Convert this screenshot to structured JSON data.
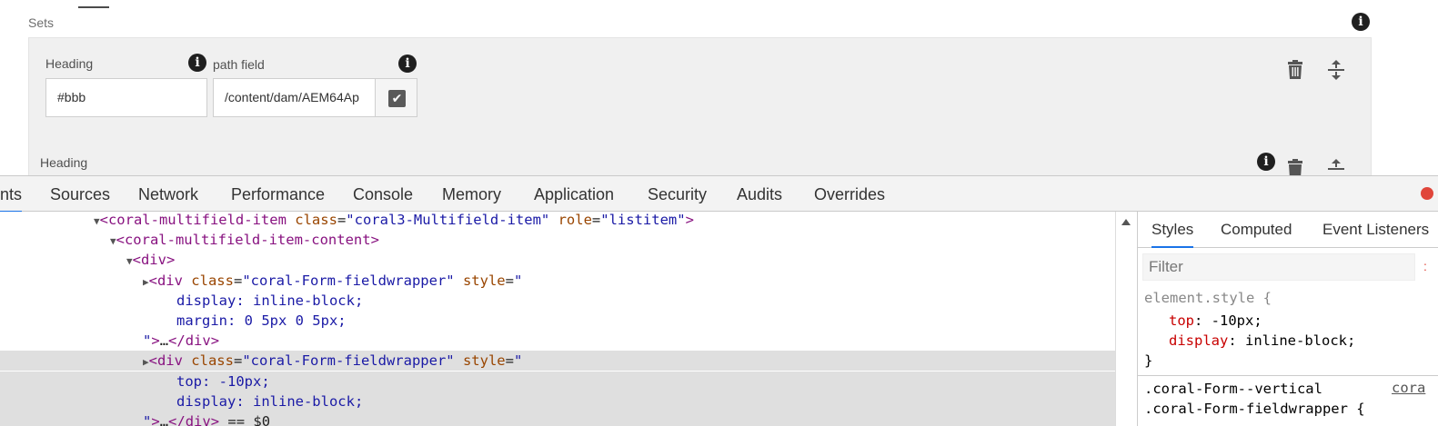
{
  "form": {
    "sets_label": "Sets",
    "item1": {
      "heading_label": "Heading",
      "heading_value": "#bbb",
      "path_label": "path field",
      "path_value": "/content/dam/AEM64Ap"
    },
    "item2": {
      "heading_label": "Heading"
    }
  },
  "devtools": {
    "tabs": [
      "nts",
      "Sources",
      "Network",
      "Performance",
      "Console",
      "Memory",
      "Application",
      "Security",
      "Audits",
      "Overrides"
    ],
    "active_tab": "nts",
    "elements": [
      {
        "indent": 103,
        "tri": "▼",
        "parts": [
          [
            "tag",
            "<coral-multifield-item "
          ],
          [
            "attr",
            "class"
          ],
          [
            "txt",
            "="
          ],
          [
            "val",
            "\"coral3-Multifield-item\""
          ],
          [
            "txt",
            " "
          ],
          [
            "attr",
            "role"
          ],
          [
            "txt",
            "="
          ],
          [
            "val",
            "\"listitem\""
          ],
          [
            "tag",
            ">"
          ]
        ]
      },
      {
        "indent": 121,
        "tri": "▼",
        "parts": [
          [
            "tag",
            "<coral-multifield-item-content>"
          ]
        ]
      },
      {
        "indent": 139,
        "tri": "▼",
        "parts": [
          [
            "tag",
            "<div>"
          ]
        ]
      },
      {
        "indent": 157,
        "tri": "▶",
        "parts": [
          [
            "tag",
            "<div "
          ],
          [
            "attr",
            "class"
          ],
          [
            "txt",
            "="
          ],
          [
            "val",
            "\"coral-Form-fieldwrapper\""
          ],
          [
            "txt",
            " "
          ],
          [
            "attr",
            "style"
          ],
          [
            "txt",
            "="
          ],
          [
            "val",
            "\""
          ]
        ]
      },
      {
        "indent": 194,
        "tri": "",
        "parts": [
          [
            "val",
            "display: inline-block;"
          ]
        ]
      },
      {
        "indent": 194,
        "tri": "",
        "parts": [
          [
            "val",
            "margin: 0 5px 0 5px;"
          ]
        ]
      },
      {
        "indent": 157,
        "tri": "",
        "parts": [
          [
            "val",
            "\""
          ],
          [
            "tag",
            ">"
          ],
          [
            "txt",
            "…"
          ],
          [
            "tag",
            "</div>"
          ]
        ]
      },
      {
        "indent": 157,
        "tri": "▶",
        "selected": true,
        "parts": [
          [
            "tag",
            "<div "
          ],
          [
            "attr",
            "class"
          ],
          [
            "txt",
            "="
          ],
          [
            "val",
            "\"coral-Form-fieldwrapper\""
          ],
          [
            "txt",
            " "
          ],
          [
            "attr",
            "style"
          ],
          [
            "txt",
            "="
          ],
          [
            "val",
            "\""
          ]
        ]
      },
      {
        "indent": 194,
        "tri": "",
        "selected": true,
        "parts": [
          [
            "val",
            "top: -10px;"
          ]
        ]
      },
      {
        "indent": 194,
        "tri": "",
        "selected": true,
        "parts": [
          [
            "val",
            "display: inline-block;"
          ]
        ]
      },
      {
        "indent": 157,
        "tri": "",
        "selected": true,
        "parts": [
          [
            "val",
            "\""
          ],
          [
            "tag",
            ">"
          ],
          [
            "txt",
            "…"
          ],
          [
            "tag",
            "</div>"
          ],
          [
            "txt",
            " == $0"
          ]
        ]
      }
    ],
    "styles_pane": {
      "tabs": [
        "Styles",
        "Computed",
        "Event Listeners"
      ],
      "active_tab": "Styles",
      "filter_placeholder": "Filter",
      "filter_extra": ":",
      "element_style_selector": "element.style {",
      "props": [
        {
          "name": "top",
          "value": "-10px;"
        },
        {
          "name": "display",
          "value": "inline-block;"
        }
      ],
      "close_brace": "}",
      "rule2_line1": ".coral-Form--vertical",
      "rule2_line2": ".coral-Form-fieldwrapper {",
      "rule2_source": "cora"
    }
  },
  "colors": {
    "accent": "#1a73e8",
    "selected_row": "#dfdfdf",
    "tag": "#881280",
    "attr_name": "#994500",
    "attr_value": "#1a1aa6",
    "css_prop": "#c80000"
  }
}
